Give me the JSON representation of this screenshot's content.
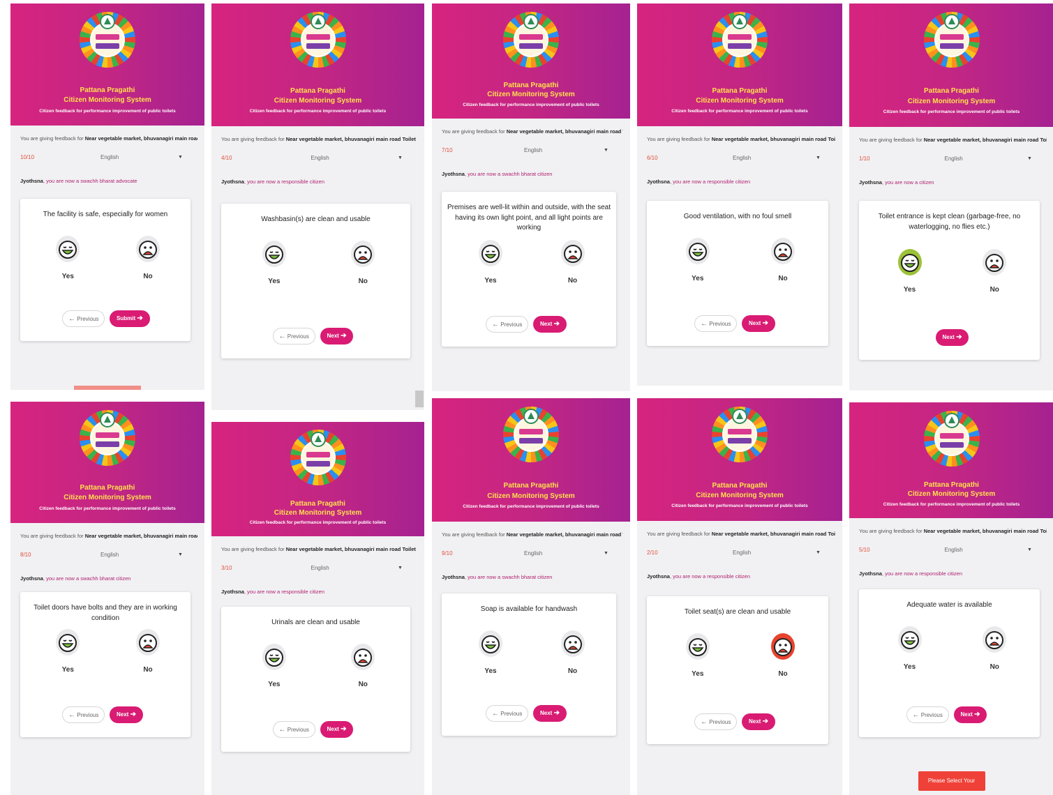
{
  "colors": {
    "header_start": "#d6247f",
    "header_end": "#a52291",
    "accent": "#d91b73",
    "progress": "#e0503c",
    "warning": "#ef4138"
  },
  "header": {
    "line1": "Pattana Pragathi",
    "line2": "Citizen Monitoring System",
    "line3": "Citizen feedback for performance improvement of public toilets"
  },
  "intro": {
    "prefix": "You are giving feedback for",
    "location": "Near vegetable market, bhuvanagiri main road Toilet"
  },
  "language": "English",
  "labels": {
    "yes": "Yes",
    "no": "No",
    "previous": "Previous",
    "next": "Next",
    "submit": "Submit",
    "warning": "Please Select Your Feedback"
  },
  "panels": [
    {
      "progress": "10/10",
      "user": "Jyothsna",
      "status": ", you are now a swachh bharat advocate",
      "question": "The facility is safe, especially for women",
      "selected": ""
    },
    {
      "progress": "4/10",
      "user": "Jyothsna",
      "status": ", you are now a responsible citizen",
      "question": "Washbasin(s) are clean and usable",
      "selected": ""
    },
    {
      "progress": "7/10",
      "user": "Jyothsna",
      "status": ", you are now a swachh bharat citizen",
      "question": "Premises are well-lit within and outside, with the seat having its own light point, and all light points are working",
      "selected": ""
    },
    {
      "progress": "6/10",
      "user": "Jyothsna",
      "status": ", you are now a responsible citizen",
      "question": "Good ventilation, with no foul smell",
      "selected": ""
    },
    {
      "progress": "1/10",
      "user": "Jyothsna",
      "status": ", you are now a citizen",
      "question": "Toilet entrance is kept clean (garbage-free, no waterlogging, no flies etc.)",
      "selected": "yes"
    },
    {
      "progress": "8/10",
      "user": "Jyothsna",
      "status": ", you are now a swachh bharat citizen",
      "question": "Toilet doors have bolts and they are in working condition",
      "selected": ""
    },
    {
      "progress": "3/10",
      "user": "Jyothsna",
      "status": ", you are now a responsible citizen",
      "question": "Urinals are clean and usable",
      "selected": ""
    },
    {
      "progress": "9/10",
      "user": "Jyothsna",
      "status": ", you are now a swachh bharat citizen",
      "question": "Soap is available for handwash",
      "selected": ""
    },
    {
      "progress": "2/10",
      "user": "Jyothsna",
      "status": ", you are now a responsible citizen",
      "question": "Toilet seat(s) are clean and usable",
      "selected": "no"
    },
    {
      "progress": "5/10",
      "user": "Jyothsna",
      "status": ", you are now a responsible citizen",
      "question": "Adequate water is available",
      "selected": ""
    }
  ]
}
